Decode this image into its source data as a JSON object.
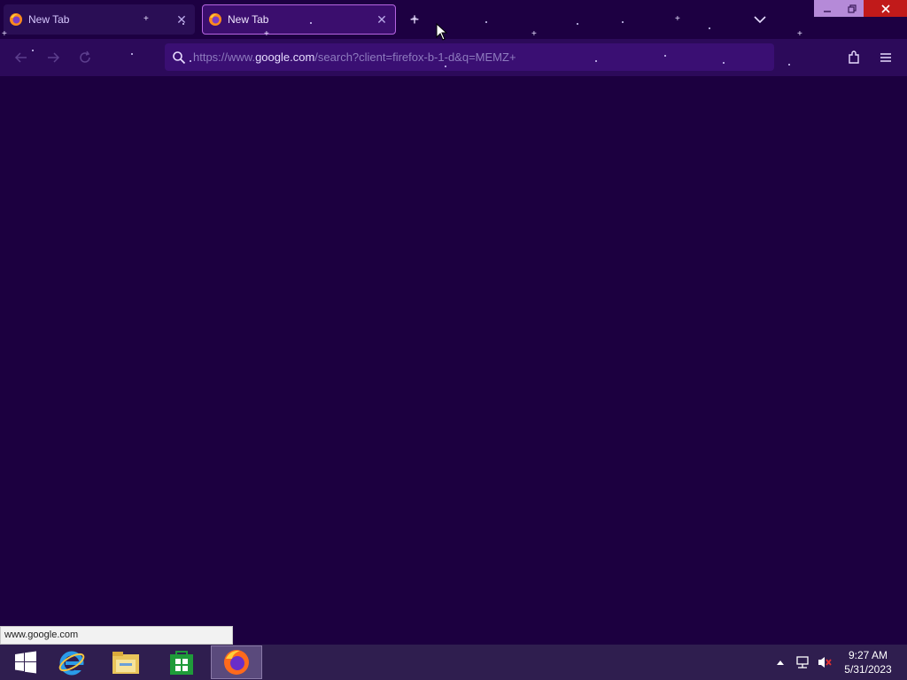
{
  "browser": {
    "tabs": [
      {
        "title": "New Tab",
        "active": false
      },
      {
        "title": "New Tab",
        "active": true
      }
    ],
    "url": {
      "prefix": "https://www.",
      "host": "google.com",
      "path": "/search?client=firefox-b-1-d&q=MEMZ+"
    },
    "status_text": "www.google.com"
  },
  "taskbar": {
    "apps": [
      "start",
      "internet-explorer",
      "file-explorer",
      "store",
      "firefox"
    ],
    "clock": {
      "time": "9:27 AM",
      "date": "5/31/2023"
    }
  },
  "colors": {
    "background": "#1c0040",
    "urlbar": "#3a0f73",
    "taskbar": "#2f1e4f",
    "close_button": "#c11a1a"
  }
}
